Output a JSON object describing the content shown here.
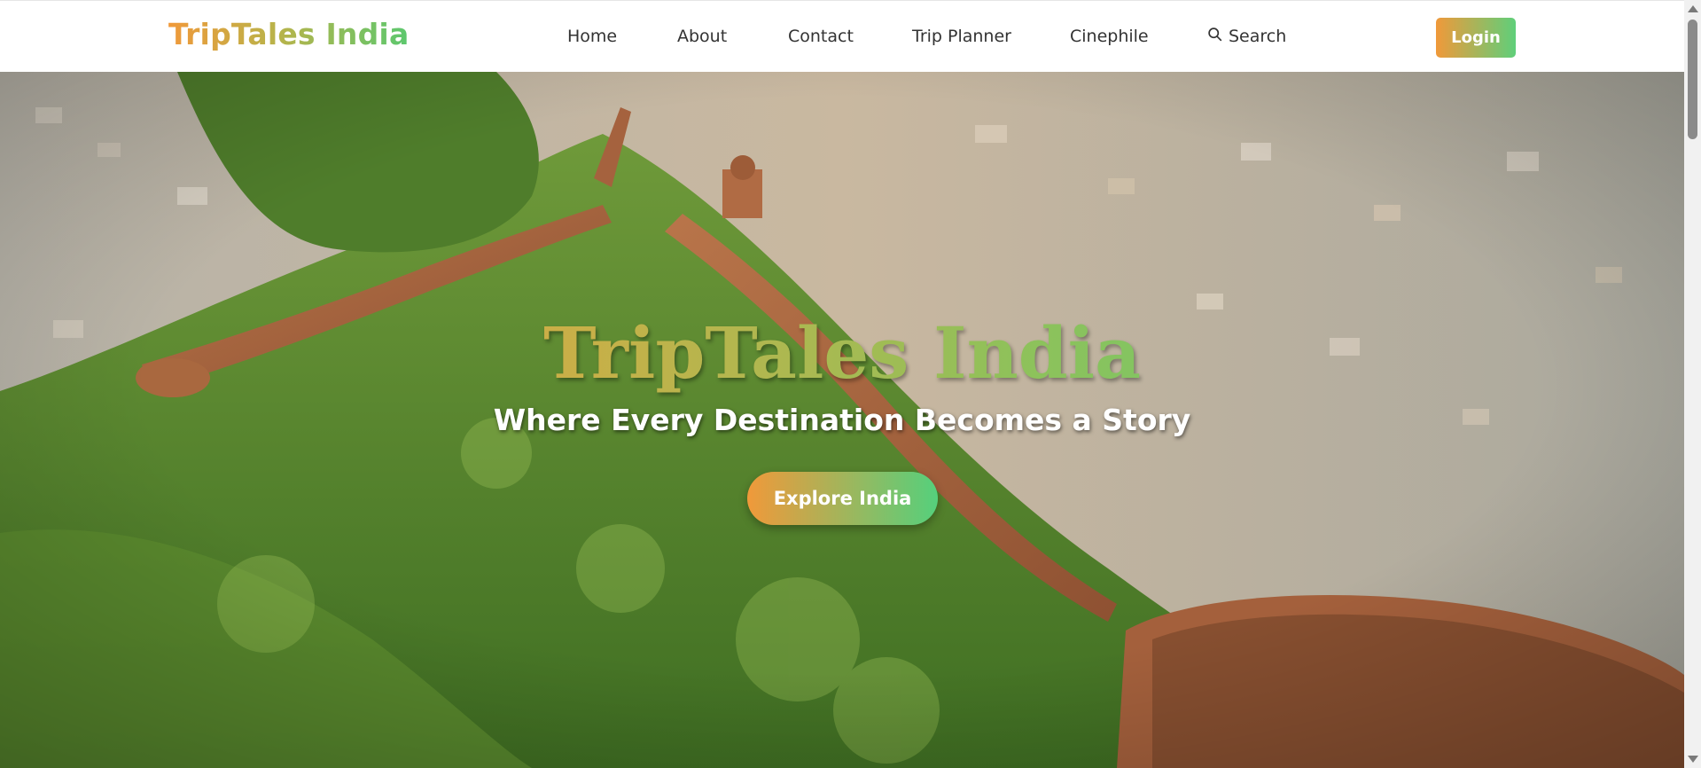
{
  "navbar": {
    "brand": "TripTales India",
    "links": [
      "Home",
      "About",
      "Contact",
      "Trip Planner",
      "Cinephile"
    ],
    "search_label": "Search",
    "login_label": "Login"
  },
  "hero": {
    "title": "TripTales India",
    "tagline": "Where Every Destination Becomes a Story",
    "cta_label": "Explore India",
    "background": "aerial-fort-wall-hillside-town"
  },
  "colors": {
    "brand_gradient_start": "#f0993a",
    "brand_gradient_end": "#55d07c",
    "nav_text": "#333333"
  },
  "icons": {
    "search": "search-icon"
  }
}
